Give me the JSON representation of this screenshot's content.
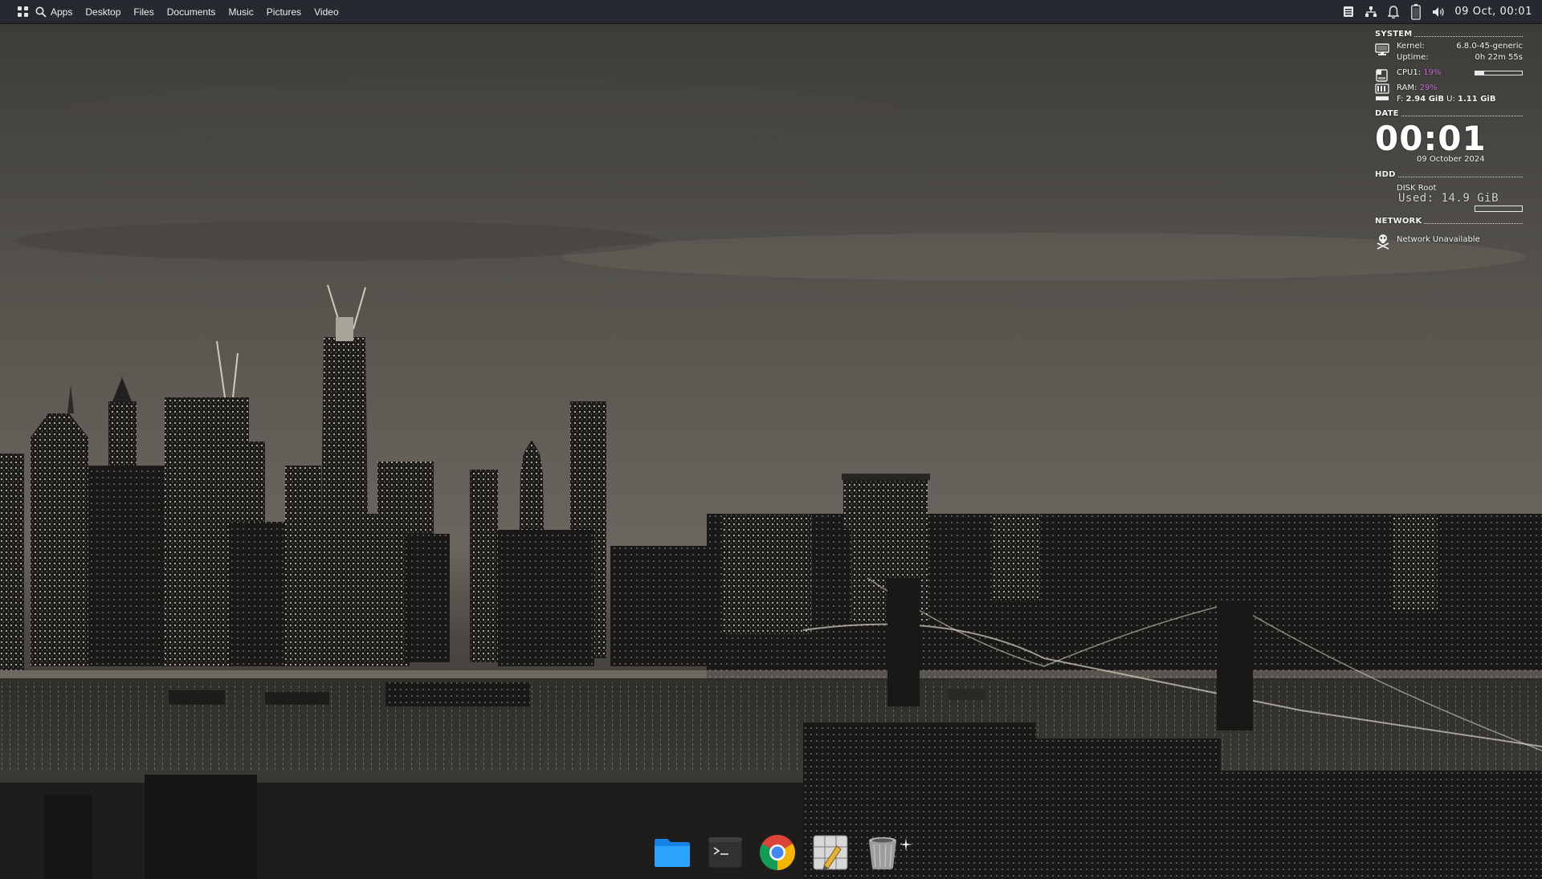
{
  "top_panel": {
    "apps_label": "Apps",
    "places": [
      "Desktop",
      "Files",
      "Documents",
      "Music",
      "Pictures",
      "Video"
    ],
    "clock": "09 Oct, 00:01",
    "tray_icons": [
      "menu-icon",
      "network-icon",
      "bell-icon",
      "battery-icon",
      "volume-icon"
    ]
  },
  "conky": {
    "system": {
      "title": "SYSTEM",
      "kernel_label": "Kernel:",
      "kernel_value": "6.8.0-45-generic",
      "uptime_label": "Uptime:",
      "uptime_value": "0h 22m 55s",
      "cpu_label": "CPU1:",
      "cpu_value": "19%",
      "cpu_fraction": 0.19,
      "ram_label": "RAM:",
      "ram_value": "29%",
      "mem_free_label": "F:",
      "mem_free_value": "2.94 GiB",
      "mem_used_label": "U:",
      "mem_used_value": "1.11 GiB"
    },
    "date": {
      "title": "DATE",
      "time": "00:01",
      "date": "09 October 2024"
    },
    "hdd": {
      "title": "HDD",
      "disk_label": "DISK Root",
      "used_text": "Used: 14.9 GiB",
      "used_fraction": 0.0
    },
    "network": {
      "title": "NETWORK",
      "status": "Network Unavailable"
    }
  },
  "dock": {
    "items": [
      "files-folder-icon",
      "terminal-icon",
      "chrome-icon",
      "text-editor-icon",
      "trash-icon"
    ]
  },
  "colors": {
    "panel_bg": "#262a30",
    "percent_accent": "#c66ad8",
    "text": "#f2f2f2"
  }
}
